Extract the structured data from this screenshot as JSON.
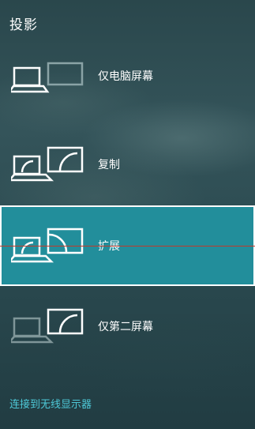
{
  "panel": {
    "title": "投影"
  },
  "options": [
    {
      "label": "仅电脑屏幕",
      "laptop": "active",
      "monitor": "dim",
      "screen": false
    },
    {
      "label": "复制",
      "laptop": "active",
      "monitor": "active",
      "screen": true
    },
    {
      "label": "扩展",
      "laptop": "active",
      "monitor": "active",
      "screen": true,
      "selected": true
    },
    {
      "label": "仅第二屏幕",
      "laptop": "dim",
      "monitor": "active",
      "screen": true
    }
  ],
  "footer": {
    "wireless_link": "连接到无线显示器"
  },
  "colors": {
    "selected_bg": "#228e9b",
    "link": "#4ec9d8",
    "indicator_line": "#c0392b"
  }
}
